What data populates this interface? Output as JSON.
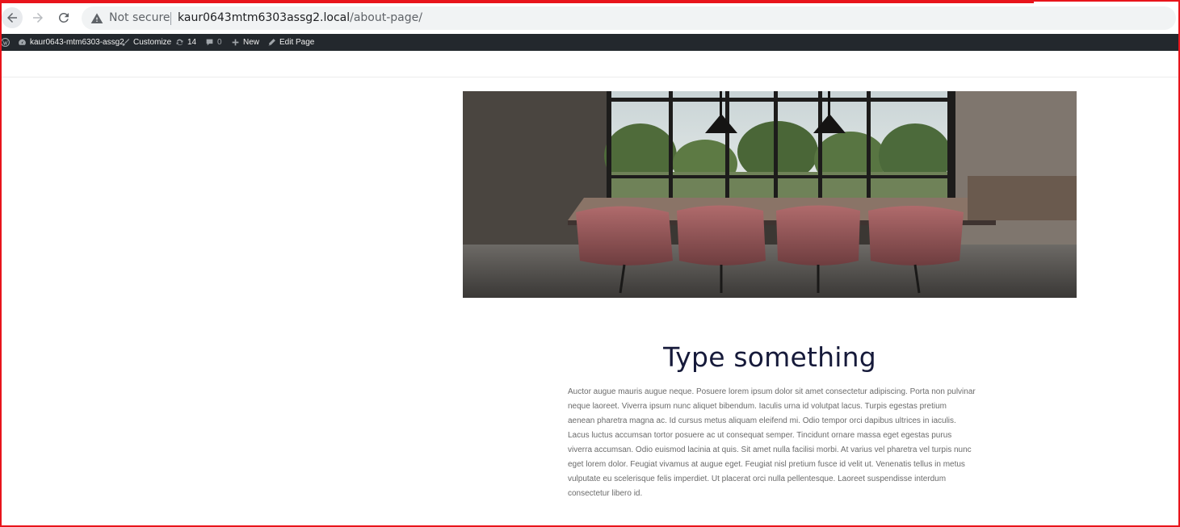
{
  "browser": {
    "security_label": "Not secure",
    "url_host": "kaur0643mtm6303assg2.local",
    "url_path": "/about-page/"
  },
  "admin_bar": {
    "site_name": "kaur0643-mtm6303-assg2",
    "customize": "Customize",
    "updates_count": "14",
    "comments_count": "0",
    "new_label": "New",
    "edit_label": "Edit Page"
  },
  "page": {
    "heading": "Type something",
    "body": "Auctor augue mauris augue neque. Posuere lorem ipsum dolor sit amet consectetur adipiscing. Porta non pulvinar neque laoreet. Viverra ipsum nunc aliquet bibendum. Iaculis urna id volutpat lacus. Turpis egestas pretium aenean pharetra magna ac. Id cursus metus aliquam eleifend mi. Odio tempor orci dapibus ultrices in iaculis. Lacus luctus accumsan tortor posuere ac ut consequat semper. Tincidunt ornare massa eget egestas purus viverra accumsan. Odio euismod lacinia at quis. Sit amet nulla facilisi morbi. At varius vel pharetra vel turpis nunc eget lorem dolor. Feugiat vivamus at augue eget. Feugiat nisl pretium fusce id velit ut. Venenatis tellus in metus vulputate eu scelerisque felis imperdiet. Ut placerat orci nulla pellentesque. Laoreet suspendisse interdum consectetur libero id."
  },
  "colors": {
    "admin_bar_bg": "#23282d",
    "heading": "#161a3a",
    "frame": "#e8141b"
  }
}
